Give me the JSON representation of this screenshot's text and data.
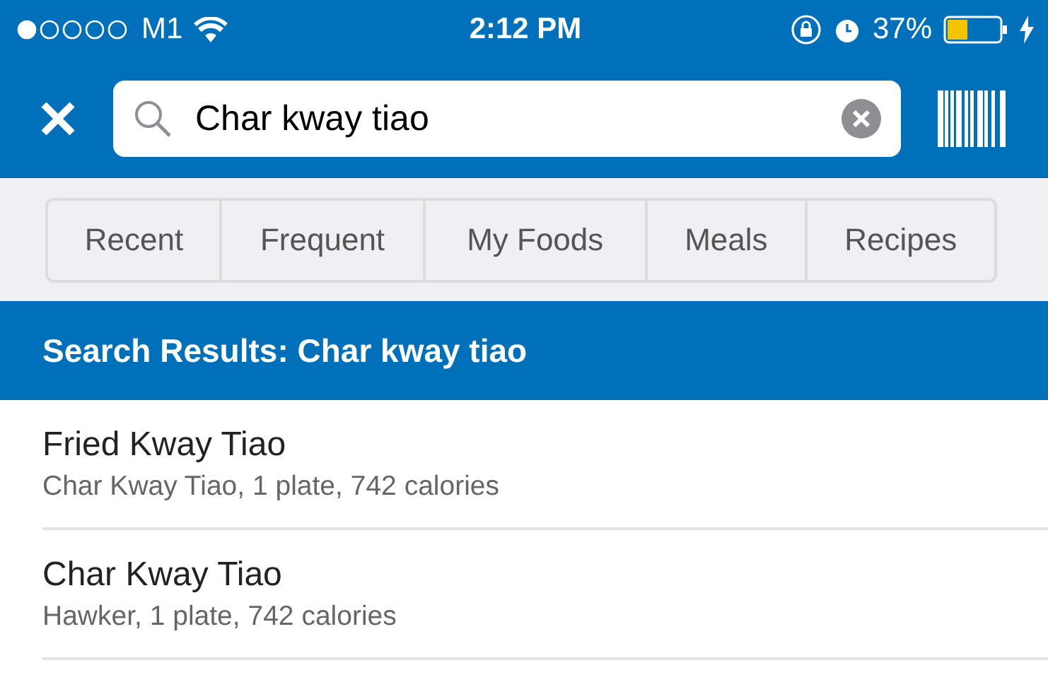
{
  "status_bar": {
    "carrier": "M1",
    "time": "2:12 PM",
    "battery": "37%"
  },
  "search": {
    "value": "Char kway tiao"
  },
  "tabs": [
    {
      "label": "Recent"
    },
    {
      "label": "Frequent"
    },
    {
      "label": "My Foods"
    },
    {
      "label": "Meals"
    },
    {
      "label": "Recipes"
    }
  ],
  "results": {
    "title": "Search Results: Char kway tiao",
    "items": [
      {
        "name": "Fried Kway Tiao",
        "detail": "Char Kway Tiao, 1 plate, 742 calories"
      },
      {
        "name": "Char Kway Tiao",
        "detail": "Hawker, 1 plate, 742 calories"
      }
    ]
  }
}
